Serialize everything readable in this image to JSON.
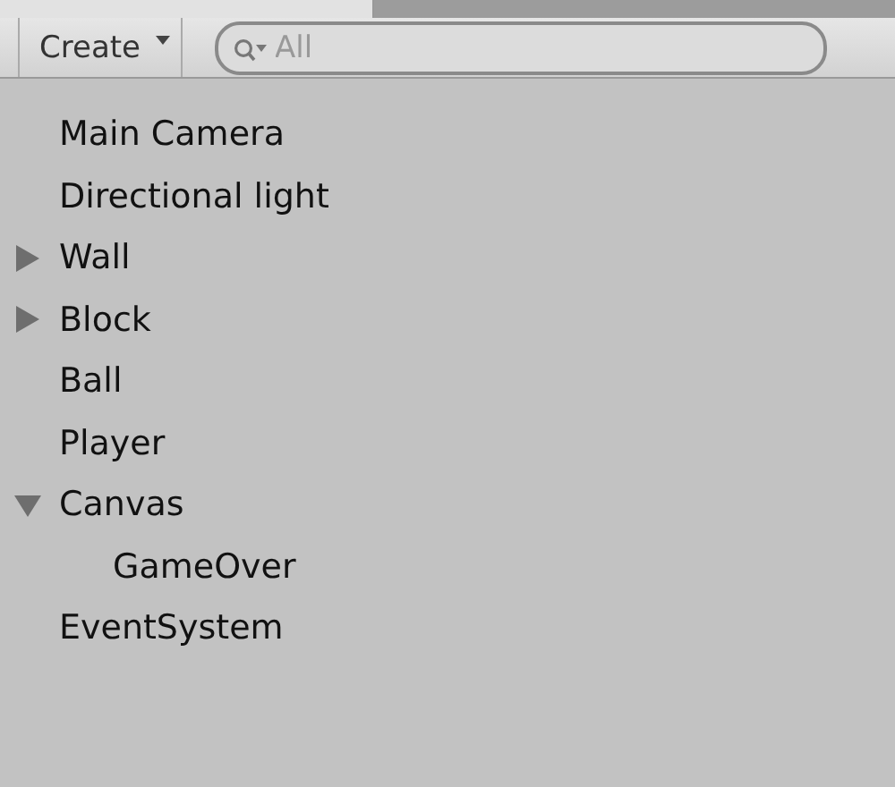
{
  "toolbar": {
    "create_button": "Create",
    "search": {
      "placeholder": "All"
    }
  },
  "hierarchy": [
    {
      "label": "Main Camera",
      "kind": "leaf"
    },
    {
      "label": "Directional light",
      "kind": "leaf"
    },
    {
      "label": "Wall",
      "kind": "group",
      "expanded": false
    },
    {
      "label": "Block",
      "kind": "group",
      "expanded": false
    },
    {
      "label": "Ball",
      "kind": "leaf"
    },
    {
      "label": "Player",
      "kind": "leaf"
    },
    {
      "label": "Canvas",
      "kind": "group",
      "expanded": true,
      "children": [
        {
          "label": "GameOver",
          "kind": "leaf"
        }
      ]
    },
    {
      "label": "EventSystem",
      "kind": "leaf"
    }
  ]
}
